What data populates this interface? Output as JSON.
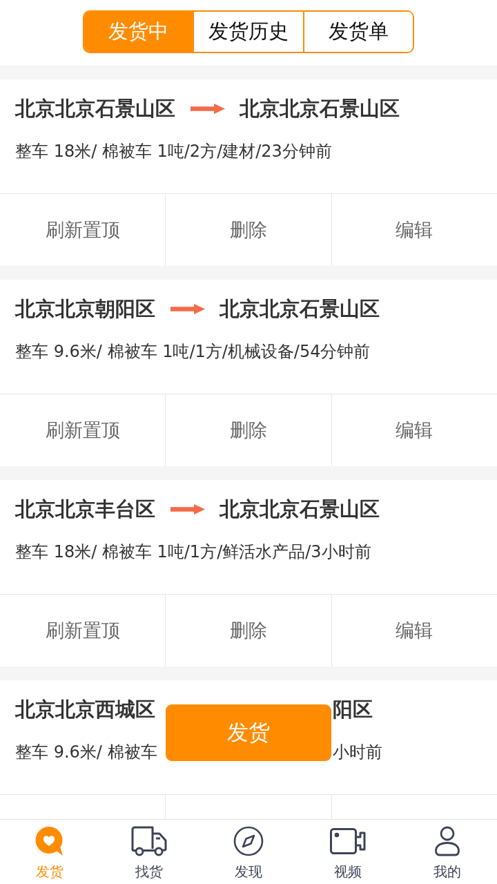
{
  "tabs": [
    {
      "label": "发货中",
      "selected": true
    },
    {
      "label": "发货历史",
      "selected": false
    },
    {
      "label": "发货单",
      "selected": false
    }
  ],
  "cards": [
    {
      "kind": "full",
      "origin": "北京北京石景山区",
      "destination": "北京北京石景山区",
      "details": "整车 18米/ 棉被车 1吨/2方/建材/23分钟前",
      "actions": [
        "刷新置顶",
        "删除",
        "编辑"
      ]
    },
    {
      "kind": "full",
      "origin": "北京北京朝阳区",
      "destination": "北京北京石景山区",
      "details": "整车 9.6米/ 棉被车 1吨/1方/机械设备/54分钟前",
      "actions": [
        "刷新置顶",
        "删除",
        "编辑"
      ]
    },
    {
      "kind": "full",
      "origin": "北京北京丰台区",
      "destination": "北京北京石景山区",
      "details": "整车 18米/ 棉被车 1吨/1方/鲜活水产品/3小时前",
      "actions": [
        "刷新置顶",
        "删除",
        "编辑"
      ]
    },
    {
      "kind": "covered",
      "origin": "北京北京西城区",
      "destination": "阳区",
      "details_parts": [
        "整车 9.6米/ 棉被车",
        "小时前"
      ]
    }
  ],
  "floating_button": {
    "label": "发货"
  },
  "nav": [
    {
      "label": "发货",
      "selected": true
    },
    {
      "label": "找货",
      "selected": false
    },
    {
      "label": "发现",
      "selected": false
    },
    {
      "label": "视频",
      "selected": false
    },
    {
      "label": "我的",
      "selected": false
    }
  ]
}
